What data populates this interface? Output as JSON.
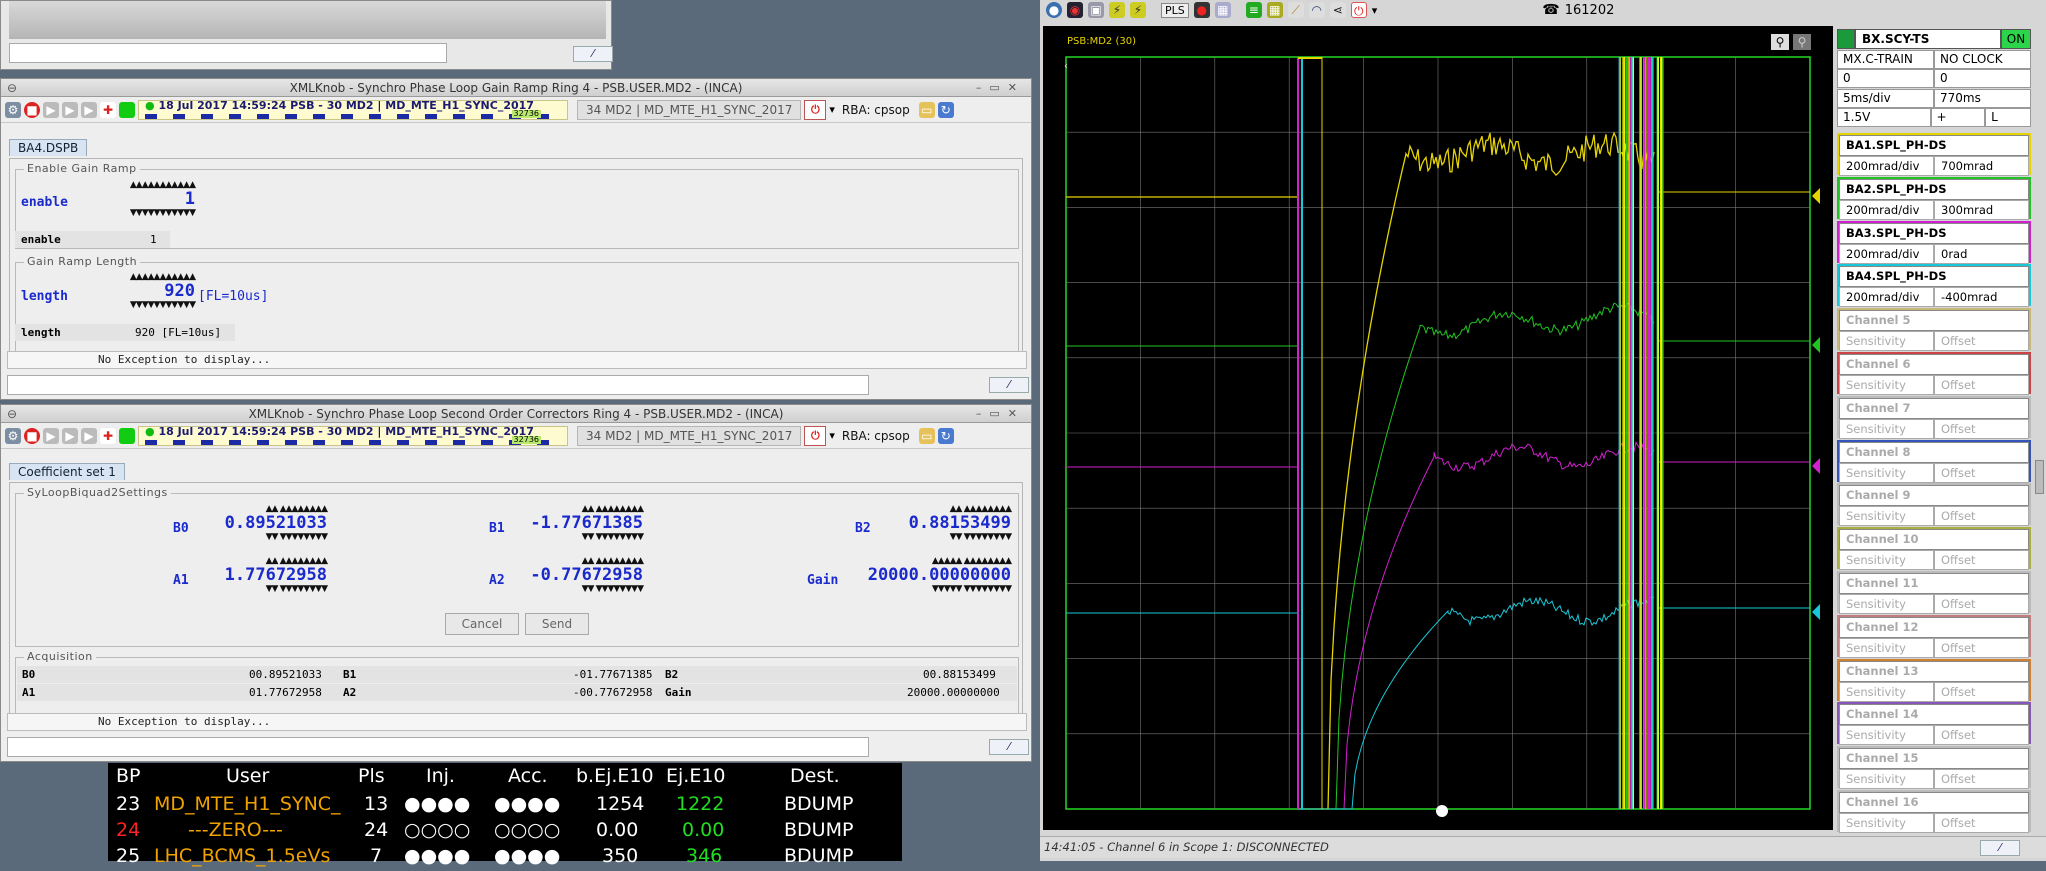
{
  "top_window": {
    "label": ""
  },
  "win1": {
    "title": "XMLKnob - Synchro Phase Loop Gain Ramp Ring 4 - PSB.USER.MD2 - (INCA)",
    "timing": "18 Jul 2017   14:59:24  PSB - 30 MD2 | MD_MTE_H1_SYNC_2017",
    "count": "32736",
    "user": "34 MD2 | MD_MTE_H1_SYNC_2017",
    "rba": "RBA: cpsop",
    "tab": "BA4.DSPB",
    "group1": "Enable Gain Ramp",
    "enable_label": "enable",
    "enable_value": "1",
    "enable_small_label": "enable",
    "enable_small_value": "1",
    "group2": "Gain Ramp Length",
    "length_label": "length",
    "length_value": "920",
    "length_unit": "[FL=10us]",
    "length_small_label": "length",
    "length_small_value": "920 [FL=10us]",
    "status": "No Exception to display..."
  },
  "win2": {
    "title": "XMLKnob - Synchro Phase Loop Second Order Correctors Ring 4 - PSB.USER.MD2 - (INCA)",
    "timing": "18 Jul 2017   14:59:24  PSB - 30 MD2 | MD_MTE_H1_SYNC_2017",
    "count": "32736",
    "user": "34 MD2 | MD_MTE_H1_SYNC_2017",
    "rba": "RBA: cpsop",
    "tab": "Coefficient set 1",
    "group1": "SyLoopBiquad2Settings",
    "knobs": [
      {
        "label": "B0",
        "value": "0.89521033"
      },
      {
        "label": "B1",
        "value": "-1.77671385"
      },
      {
        "label": "B2",
        "value": "0.88153499"
      },
      {
        "label": "A1",
        "value": "1.77672958"
      },
      {
        "label": "A2",
        "value": "-0.77672958"
      },
      {
        "label": "Gain",
        "value": "20000.00000000"
      }
    ],
    "cancel": "Cancel",
    "send": "Send",
    "group2": "Acquisition",
    "acq": [
      {
        "label": "B0",
        "value": "00.89521033"
      },
      {
        "label": "B1",
        "value": "-01.77671385"
      },
      {
        "label": "B2",
        "value": "00.88153499"
      },
      {
        "label": "A1",
        "value": "01.77672958"
      },
      {
        "label": "A2",
        "value": "-00.77672958"
      },
      {
        "label": "Gain",
        "value": "20000.00000000"
      }
    ],
    "status": "No Exception to display..."
  },
  "beam_table": {
    "headers": [
      "BP",
      "User",
      "Pls",
      "Inj.",
      "Acc.",
      "b.Ej.E10",
      "Ej.E10",
      "Dest."
    ],
    "rows": [
      {
        "bp": "23",
        "user": "MD_MTE_H1_SYNC_",
        "pls": "13",
        "inj": "●●●●",
        "acc": "●●●●",
        "bej": "1254",
        "ej": "1222",
        "dest": "BDUMP"
      },
      {
        "bp": "24",
        "user": "---ZERO---",
        "pls": "24",
        "inj": "○○○○",
        "acc": "○○○○",
        "bej": "0.00",
        "ej": "0.00",
        "dest": "BDUMP"
      },
      {
        "bp": "25",
        "user": "LHC_BCMS_1.5eVs",
        "pls": "7",
        "inj": "●●●●",
        "acc": "●●●●",
        "bej": "350",
        "ej": "346",
        "dest": "BDUMP"
      }
    ]
  },
  "scope": {
    "toolbar_pls": "PLS",
    "phone": "161202",
    "plot_label": "PSB:MD2 (30)",
    "device": "BX.SCY-TS",
    "on": "ON",
    "info": [
      [
        "MX.C-TRAIN",
        "NO CLOCK"
      ],
      [
        "0",
        "0"
      ],
      [
        "5ms/div",
        "770ms"
      ],
      [
        "1.5V",
        "+",
        "L"
      ]
    ],
    "channels": [
      {
        "name": "BA1.SPL_PH-DS",
        "sens": "200mrad/div",
        "offset": "700mrad",
        "color": "#e6d400",
        "active": true
      },
      {
        "name": "BA2.SPL_PH-DS",
        "sens": "200mrad/div",
        "offset": "300mrad",
        "color": "#22c422",
        "active": true
      },
      {
        "name": "BA3.SPL_PH-DS",
        "sens": "200mrad/div",
        "offset": "0rad",
        "color": "#d020d0",
        "active": true
      },
      {
        "name": "BA4.SPL_PH-DS",
        "sens": "200mrad/div",
        "offset": "-400mrad",
        "color": "#18c8d8",
        "active": true
      },
      {
        "name": "Channel 5",
        "sens": "Sensitivity",
        "offset": "Offset",
        "color": "#c8b878",
        "active": false
      },
      {
        "name": "Channel 6",
        "sens": "Sensitivity",
        "offset": "Offset",
        "color": "#cc4444",
        "active": false
      },
      {
        "name": "Channel 7",
        "sens": "Sensitivity",
        "offset": "Offset",
        "color": "#bbbbbb",
        "active": false
      },
      {
        "name": "Channel 8",
        "sens": "Sensitivity",
        "offset": "Offset",
        "color": "#3355bb",
        "active": false
      },
      {
        "name": "Channel 9",
        "sens": "Sensitivity",
        "offset": "Offset",
        "color": "#bbbbbb",
        "active": false
      },
      {
        "name": "Channel 10",
        "sens": "Sensitivity",
        "offset": "Offset",
        "color": "#a8b040",
        "active": false
      },
      {
        "name": "Channel 11",
        "sens": "Sensitivity",
        "offset": "Offset",
        "color": "#bbbbbb",
        "active": false
      },
      {
        "name": "Channel 12",
        "sens": "Sensitivity",
        "offset": "Offset",
        "color": "#c08080",
        "active": false
      },
      {
        "name": "Channel 13",
        "sens": "Sensitivity",
        "offset": "Offset",
        "color": "#d08030",
        "active": false
      },
      {
        "name": "Channel 14",
        "sens": "Sensitivity",
        "offset": "Offset",
        "color": "#8855bb",
        "active": false
      },
      {
        "name": "Channel 15",
        "sens": "Sensitivity",
        "offset": "Offset",
        "color": "#bbbbbb",
        "active": false
      },
      {
        "name": "Channel 16",
        "sens": "Sensitivity",
        "offset": "Offset",
        "color": "#bbbbbb",
        "active": false
      }
    ],
    "markers": [
      "1",
      "2",
      "3",
      "4"
    ],
    "status": "14:41:05 - Channel 6 in Scope 1: DISCONNECTED"
  }
}
